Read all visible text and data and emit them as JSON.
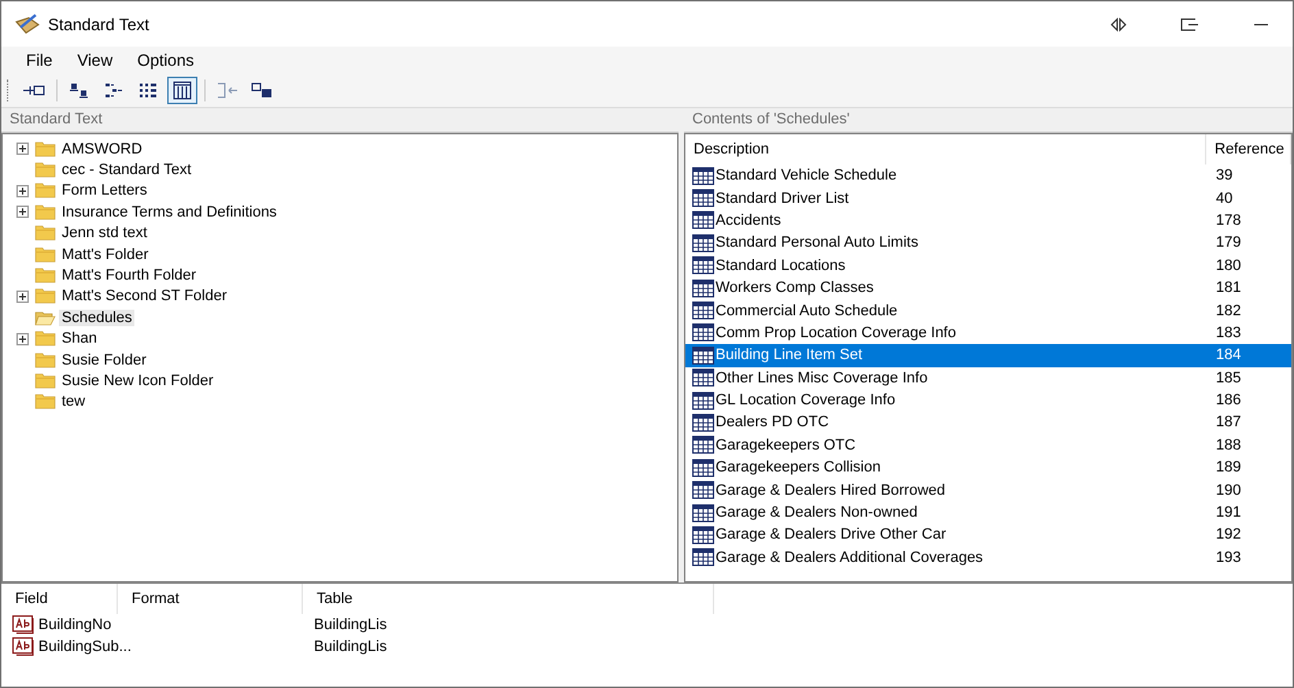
{
  "window": {
    "title": "Standard Text"
  },
  "menu": [
    "File",
    "View",
    "Options"
  ],
  "toolbar": [
    {
      "kind": "pin",
      "selected": false
    },
    {
      "kind": "sep"
    },
    {
      "kind": "small",
      "selected": false
    },
    {
      "kind": "tree",
      "selected": false
    },
    {
      "kind": "list",
      "selected": false
    },
    {
      "kind": "grid",
      "selected": true
    },
    {
      "kind": "sep"
    },
    {
      "kind": "merge",
      "selected": false
    },
    {
      "kind": "dual",
      "selected": false
    }
  ],
  "left_panel": {
    "title": "Standard Text",
    "tree": [
      {
        "label": "AMSWORD",
        "expandable": true,
        "selected": false
      },
      {
        "label": "cec - Standard Text",
        "expandable": false,
        "selected": false
      },
      {
        "label": "Form Letters",
        "expandable": true,
        "selected": false
      },
      {
        "label": "Insurance Terms and Definitions",
        "expandable": true,
        "selected": false
      },
      {
        "label": "Jenn std text",
        "expandable": false,
        "selected": false
      },
      {
        "label": "Matt's Folder",
        "expandable": false,
        "selected": false
      },
      {
        "label": "Matt's Fourth Folder",
        "expandable": false,
        "selected": false
      },
      {
        "label": "Matt's Second ST Folder",
        "expandable": true,
        "selected": false
      },
      {
        "label": "Schedules",
        "expandable": false,
        "selected": true
      },
      {
        "label": "Shan",
        "expandable": true,
        "selected": false
      },
      {
        "label": "Susie Folder",
        "expandable": false,
        "selected": false
      },
      {
        "label": "Susie New Icon Folder",
        "expandable": false,
        "selected": false
      },
      {
        "label": "tew",
        "expandable": false,
        "selected": false
      }
    ]
  },
  "right_panel": {
    "title": "Contents of 'Schedules'",
    "columns": [
      "Description",
      "Reference"
    ],
    "rows": [
      {
        "description": "Standard Vehicle Schedule",
        "reference": "39",
        "selected": false
      },
      {
        "description": "Standard Driver List",
        "reference": "40",
        "selected": false
      },
      {
        "description": "Accidents",
        "reference": "178",
        "selected": false
      },
      {
        "description": "Standard Personal Auto Limits",
        "reference": "179",
        "selected": false
      },
      {
        "description": "Standard Locations",
        "reference": "180",
        "selected": false
      },
      {
        "description": "Workers Comp Classes",
        "reference": "181",
        "selected": false
      },
      {
        "description": "Commercial Auto Schedule",
        "reference": "182",
        "selected": false
      },
      {
        "description": "Comm Prop Location Coverage Info",
        "reference": "183",
        "selected": false
      },
      {
        "description": "Building Line Item Set",
        "reference": "184",
        "selected": true
      },
      {
        "description": "Other Lines Misc Coverage Info",
        "reference": "185",
        "selected": false
      },
      {
        "description": "GL Location Coverage Info",
        "reference": "186",
        "selected": false
      },
      {
        "description": "Dealers PD OTC",
        "reference": "187",
        "selected": false
      },
      {
        "description": "Garagekeepers OTC",
        "reference": "188",
        "selected": false
      },
      {
        "description": "Garagekeepers Collision",
        "reference": "189",
        "selected": false
      },
      {
        "description": "Garage & Dealers Hired Borrowed",
        "reference": "190",
        "selected": false
      },
      {
        "description": "Garage & Dealers Non-owned",
        "reference": "191",
        "selected": false
      },
      {
        "description": "Garage & Dealers Drive Other Car",
        "reference": "192",
        "selected": false
      },
      {
        "description": "Garage & Dealers Additional Coverages",
        "reference": "193",
        "selected": false
      }
    ]
  },
  "fields_panel": {
    "columns": [
      "Field",
      "Format",
      "Table"
    ],
    "rows": [
      {
        "field": "BuildingNo",
        "table": "BuildingLis"
      },
      {
        "field": "BuildingSub...",
        "table": "BuildingLis"
      }
    ]
  }
}
